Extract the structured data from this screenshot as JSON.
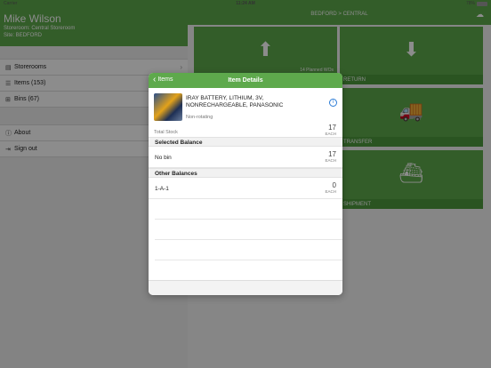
{
  "status": {
    "carrier": "Carrier",
    "time": "11:24 AM",
    "battery": "78%"
  },
  "sidebar": {
    "user_name": "Mike Wilson",
    "storeroom": "Storeroom: Central Storeroom",
    "site": "Site: BEDFORD",
    "items": [
      {
        "label": "Storerooms",
        "icon": "storeroom-icon"
      },
      {
        "label": "Items (153)",
        "icon": "list-icon"
      },
      {
        "label": "Bins (67)",
        "icon": "bins-icon"
      }
    ],
    "bottom_items": [
      {
        "label": "About",
        "icon": "info-icon"
      },
      {
        "label": "Sign out",
        "icon": "sign-out-icon"
      }
    ]
  },
  "main": {
    "breadcrumb": "BEDFORD > CENTRAL",
    "tiles": [
      {
        "label": "",
        "sub": "14 Planned WOs",
        "icon": "receive-icon"
      },
      {
        "label": "RETURN",
        "icon": "return-icon"
      },
      {
        "label": "",
        "icon": ""
      },
      {
        "label": "TRANSFER",
        "icon": "truck-icon"
      },
      {
        "label": "",
        "icon": ""
      },
      {
        "label": "SHIPMENT",
        "icon": "ship-icon"
      }
    ]
  },
  "modal": {
    "back_label": "Items",
    "title": "Item Details",
    "item": {
      "description": "IRAY BATTERY, LITHIUM, 3V, NONRECHARGEABLE, PANASONIC",
      "rotation": "Non-rotating"
    },
    "total_stock": {
      "label": "Total Stock",
      "qty": "17",
      "unit": "EACH"
    },
    "selected_balance": {
      "heading": "Selected Balance",
      "rows": [
        {
          "bin": "No bin",
          "qty": "17",
          "unit": "EACH"
        }
      ]
    },
    "other_balances": {
      "heading": "Other Balances",
      "rows": [
        {
          "bin": "1-A-1",
          "qty": "0",
          "unit": "EACH"
        }
      ]
    }
  },
  "colors": {
    "brand_green": "#5ea94c",
    "info_blue": "#2a7bd6"
  }
}
